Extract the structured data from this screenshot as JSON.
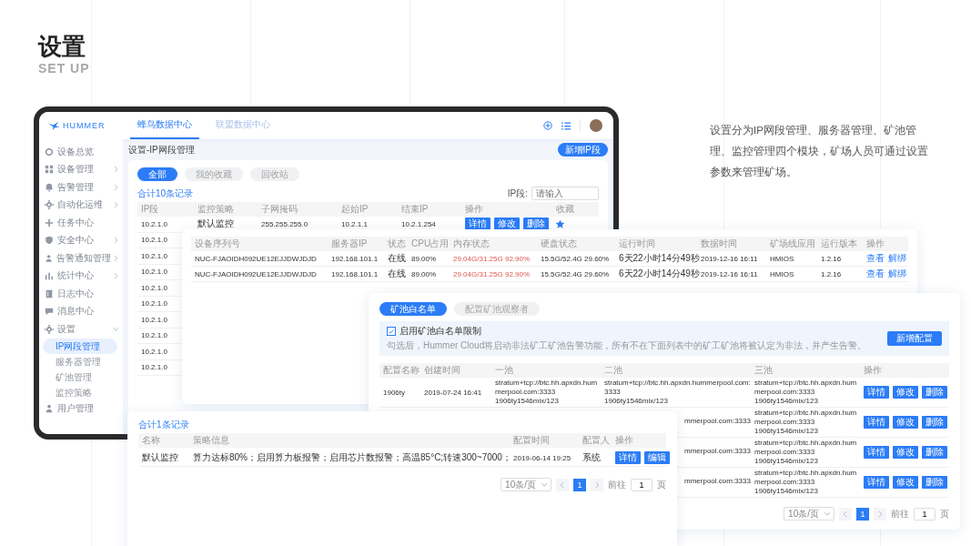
{
  "title": "设置",
  "subtitle": "SET UP",
  "description": "设置分为IP网段管理、服务器管理、矿池管理、监控管理四个模块，矿场人员可通过设置参数来管理矿场。",
  "app": {
    "logo": "HUMMER",
    "tabs": [
      {
        "label": "蜂鸟数据中心",
        "selected": true
      },
      {
        "label": "联盟数据中心",
        "selected": false
      }
    ],
    "sidebar": [
      {
        "label": "设备总览"
      },
      {
        "label": "设备管理",
        "expanded": false
      },
      {
        "label": "告警管理",
        "expanded": false
      },
      {
        "label": "自动化运维",
        "expanded": false
      },
      {
        "label": "任务中心"
      },
      {
        "label": "安全中心",
        "expanded": false
      },
      {
        "label": "告警通知管理",
        "expanded": false
      },
      {
        "label": "统计中心",
        "expanded": false
      },
      {
        "label": "日志中心"
      },
      {
        "label": "消息中心"
      },
      {
        "label": "设置",
        "expanded": true,
        "children": [
          {
            "label": "IP网段管理",
            "selected": true
          },
          {
            "label": "服务器管理",
            "selected": false
          },
          {
            "label": "矿池管理",
            "selected": false
          },
          {
            "label": "监控策略",
            "selected": false
          }
        ]
      },
      {
        "label": "用户管理"
      }
    ],
    "breadcrumb": "设置-IP网段管理",
    "add_button": "新增IP段",
    "ip_card": {
      "filters": [
        {
          "label": "全部",
          "selected": true
        },
        {
          "label": "我的收藏",
          "selected": false
        },
        {
          "label": "回收站",
          "selected": false
        }
      ],
      "total": "合计10条记录",
      "search": {
        "label": "IP段:",
        "placeholder": "请输入"
      },
      "columns": [
        "IP段",
        "监控策略",
        "子网掩码",
        "起始IP",
        "结束IP",
        "操作",
        "收藏"
      ],
      "rows": [
        {
          "cells": [
            "10.2.1.0",
            "默认监控",
            "255.255.255.0",
            "10.2.1.1",
            "10.2.1.254"
          ],
          "actions": [
            "详情",
            "修改",
            "删除"
          ],
          "favorite": true
        },
        {
          "cells": [
            "10.2.1.0"
          ]
        },
        {
          "cells": [
            "10.2.1.0"
          ]
        },
        {
          "cells": [
            "10.2.1.0"
          ]
        },
        {
          "cells": [
            "10.2.1.0"
          ]
        },
        {
          "cells": [
            "10.2.1.0"
          ]
        },
        {
          "cells": [
            "10.2.1.0"
          ]
        },
        {
          "cells": [
            "10.2.1.0"
          ]
        },
        {
          "cells": [
            "10.2.1.0"
          ]
        },
        {
          "cells": [
            "10.2.1.0"
          ]
        }
      ]
    }
  },
  "server_panel": {
    "columns": [
      "设备序列号",
      "服务器IP",
      "状态",
      "CPU占用",
      "内存状态",
      "硬盘状态",
      "运行时间",
      "数据时间",
      "矿场线应用",
      "运行版本",
      "操作"
    ],
    "rows": [
      {
        "serial": "NUC-FJAOIDH092UE12EJJDWJDJD",
        "ip": "192.168.101.1",
        "status": "在线",
        "cpu": "89.00%",
        "memory": "29.04G/31.25G 92.90%",
        "memory_warning": true,
        "disk": "15.5G/52.4G 29.60%",
        "runtime": "6天22小时14分49秒",
        "data_time": "2019-12-16 16:11",
        "app": "HMIOS",
        "version": "1.2.16",
        "actions": [
          "查看",
          "解绑"
        ]
      },
      {
        "serial": "NUC-FJAOIDH092UE12EJJDWJDJD",
        "ip": "192.168.101.1",
        "status": "在线",
        "cpu": "89.00%",
        "memory": "29.04G/31.25G 92.90%",
        "memory_warning": true,
        "disk": "15.5G/52.4G 29.60%",
        "runtime": "6天22小时14分49秒",
        "data_time": "2019-12-16 16:11",
        "app": "HMIOS",
        "version": "1.2.16",
        "actions": [
          "查看",
          "解绑"
        ]
      }
    ]
  },
  "pool_panel": {
    "tabs": [
      {
        "label": "矿池白名单",
        "selected": true
      },
      {
        "label": "配置矿池观察者",
        "selected": false
      }
    ],
    "whitelist": {
      "checked": true,
      "label": "启用矿池白名单限制",
      "note": "勾选后，Hummer Cloud将启动非法矿工矿池告警功能，所有不在下面列表中的矿工矿池将被认定为非法，并产生告警。",
      "button": "新增配置"
    },
    "columns": [
      "配置名称",
      "创建时间",
      "一池",
      "二池",
      "三池",
      "操作"
    ],
    "rows": [
      {
        "name": "1906ty",
        "created": "2019-07-24 16:41",
        "pool_1": {
          "url": "stratum+tcp://btc.hh.apxdn.hummerpool.com:3333",
          "user": "1906ty1546mix/123"
        },
        "pool_2": {
          "url": "stratum+tcp://btc.hh.apxdn.hummerpool.com:3333",
          "user": "1906ty1546mix/123"
        },
        "pool_3": {
          "url": "stratum+tcp://btc.hh.apxdn.hummerpool.com:3333",
          "user": "1906ty1546mix/123"
        },
        "actions": [
          "详情",
          "修改",
          "删除"
        ]
      },
      {
        "pool_2": {
          "url": "mmerpool.com:3333"
        },
        "pool_3": {
          "url": "stratum+tcp://btc.hh.apxdn.hummerpool.com:3333",
          "user": "1906ty1546mix/123"
        },
        "actions": [
          "详情",
          "修改",
          "删除"
        ]
      },
      {
        "pool_2": {
          "url": "mmerpool.com:3333"
        },
        "pool_3": {
          "url": "stratum+tcp://btc.hh.apxdn.hummerpool.com:3333",
          "user": "1906ty1546mix/123"
        },
        "actions": [
          "详情",
          "修改",
          "删除"
        ]
      },
      {
        "pool_2": {
          "url": "mmerpool.com:3333"
        },
        "pool_3": {
          "url": "stratum+tcp://btc.hh.apxdn.hummerpool.com:3333",
          "user": "1906ty1546mix/123"
        },
        "actions": [
          "详情",
          "修改",
          "删除"
        ]
      }
    ],
    "pagination": {
      "page_size": "10条/页",
      "pages": [
        {
          "label": "1",
          "selected": true
        }
      ],
      "goto_label": "前往",
      "goto_value": "1",
      "unit": "页"
    }
  },
  "policy_panel": {
    "total": "合计1条记录",
    "columns": [
      "名称",
      "策略信息",
      "配置时间",
      "配置人",
      "操作"
    ],
    "rows": [
      {
        "name": "默认监控",
        "info": "算力达标80%；启用算力板报警；启用芯片数报警；高温85°C;转速300~7000；",
        "time": "2019-06-14 19:25",
        "person": "系统",
        "actions": [
          "详情",
          "编辑"
        ]
      }
    ],
    "pagination": {
      "page_size": "10条/页",
      "pages": [
        {
          "label": "1",
          "selected": true
        }
      ],
      "goto_label": "前往",
      "goto_value": "1",
      "unit": "页"
    }
  }
}
